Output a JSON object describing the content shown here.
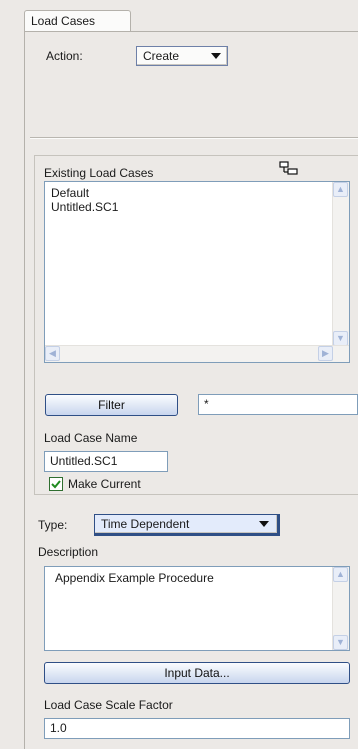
{
  "tab": {
    "label": "Load Cases"
  },
  "action": {
    "label": "Action:",
    "value": "Create"
  },
  "existing": {
    "label": "Existing Load Cases",
    "items": [
      "Default",
      "Untitled.SC1"
    ],
    "icon": "tree-view-icon"
  },
  "filter": {
    "button_label": "Filter",
    "value": "*"
  },
  "load_case_name": {
    "label": "Load Case Name",
    "value": "Untitled.SC1"
  },
  "make_current": {
    "label": "Make Current",
    "checked": true
  },
  "type": {
    "label": "Type:",
    "value": "Time Dependent"
  },
  "description": {
    "label": "Description",
    "value": "Appendix Example Procedure"
  },
  "input_data": {
    "button_label": "Input Data..."
  },
  "scale_factor": {
    "label": "Load Case Scale Factor",
    "value": "1.0"
  }
}
